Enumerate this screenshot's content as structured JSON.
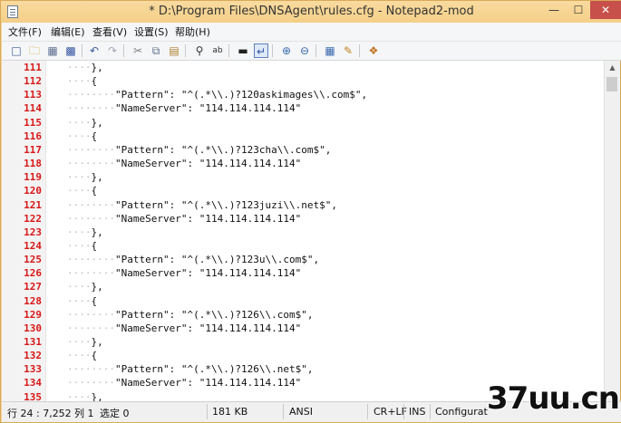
{
  "window": {
    "title": "* D:\\Program Files\\DNSAgent\\rules.cfg - Notepad2-mod",
    "min_label": "—",
    "max_label": "☐",
    "close_label": "✕"
  },
  "menu": [
    {
      "label": "文件(F)"
    },
    {
      "label": "编辑(E)"
    },
    {
      "label": "查看(V)"
    },
    {
      "label": "设置(S)"
    },
    {
      "label": "帮助(H)"
    }
  ],
  "toolbar_icons": [
    "new-file-icon",
    "open-file-icon",
    "browse-icon",
    "save-icon",
    "undo-icon",
    "redo-icon",
    "cut-icon",
    "copy-icon",
    "paste-icon",
    "find-icon",
    "replace-icon",
    "word-wrap-icon",
    "view-whitespace-icon",
    "zoom-in-icon",
    "zoom-out-icon",
    "scheme-icon",
    "customize-icon",
    "always-on-top-icon"
  ],
  "editor": {
    "lines": [
      {
        "num": "111",
        "indent": "····",
        "text": "},"
      },
      {
        "num": "112",
        "indent": "····",
        "text": "{"
      },
      {
        "num": "113",
        "indent": "········",
        "text": "\"Pattern\": \"^(.*\\\\.)?120askimages\\\\.com$\","
      },
      {
        "num": "114",
        "indent": "········",
        "text": "\"NameServer\": \"114.114.114.114\""
      },
      {
        "num": "115",
        "indent": "····",
        "text": "},"
      },
      {
        "num": "116",
        "indent": "····",
        "text": "{"
      },
      {
        "num": "117",
        "indent": "········",
        "text": "\"Pattern\": \"^(.*\\\\.)?123cha\\\\.com$\","
      },
      {
        "num": "118",
        "indent": "········",
        "text": "\"NameServer\": \"114.114.114.114\""
      },
      {
        "num": "119",
        "indent": "····",
        "text": "},"
      },
      {
        "num": "120",
        "indent": "····",
        "text": "{"
      },
      {
        "num": "121",
        "indent": "········",
        "text": "\"Pattern\": \"^(.*\\\\.)?123juzi\\\\.net$\","
      },
      {
        "num": "122",
        "indent": "········",
        "text": "\"NameServer\": \"114.114.114.114\""
      },
      {
        "num": "123",
        "indent": "····",
        "text": "},"
      },
      {
        "num": "124",
        "indent": "····",
        "text": "{"
      },
      {
        "num": "125",
        "indent": "········",
        "text": "\"Pattern\": \"^(.*\\\\.)?123u\\\\.com$\","
      },
      {
        "num": "126",
        "indent": "········",
        "text": "\"NameServer\": \"114.114.114.114\""
      },
      {
        "num": "127",
        "indent": "····",
        "text": "},"
      },
      {
        "num": "128",
        "indent": "····",
        "text": "{"
      },
      {
        "num": "129",
        "indent": "········",
        "text": "\"Pattern\": \"^(.*\\\\.)?126\\\\.com$\","
      },
      {
        "num": "130",
        "indent": "········",
        "text": "\"NameServer\": \"114.114.114.114\""
      },
      {
        "num": "131",
        "indent": "····",
        "text": "},"
      },
      {
        "num": "132",
        "indent": "····",
        "text": "{"
      },
      {
        "num": "133",
        "indent": "········",
        "text": "\"Pattern\": \"^(.*\\\\.)?126\\\\.net$\","
      },
      {
        "num": "134",
        "indent": "········",
        "text": "\"NameServer\": \"114.114.114.114\""
      },
      {
        "num": "135",
        "indent": "····",
        "text": "},"
      }
    ]
  },
  "status": {
    "position": "行 24 : 7,252",
    "column": "列 1",
    "selection": "选定 0",
    "size": "181 KB",
    "encoding": "ANSI",
    "line_ending": "CR+LF",
    "insert_mode": "INS",
    "scheme": "Configuration"
  },
  "watermark": "37uu.cn",
  "colors": {
    "line_number": "#d81818",
    "title_bar": "#f7d69a",
    "close_button": "#c7504a"
  }
}
